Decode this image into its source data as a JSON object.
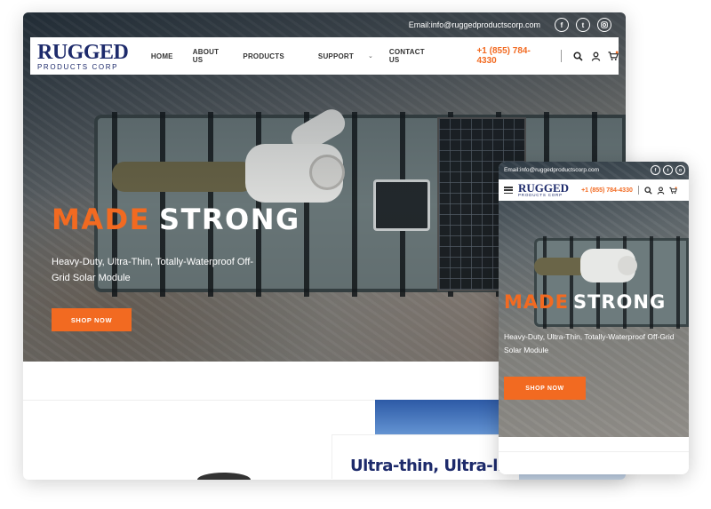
{
  "desktop": {
    "topbar": {
      "email": "Email:info@ruggedproductscorp.com",
      "socials": [
        "facebook-icon",
        "twitter-icon",
        "instagram-icon"
      ]
    },
    "logo": {
      "main": "RUGGED",
      "sub": "PRODUCTS CORP"
    },
    "nav": {
      "home": "HOME",
      "about": "ABOUT US",
      "products": "PRODUCTS",
      "support": "SUPPORT",
      "contact": "CONTACT US",
      "phone": "+1 (855) 784-4330",
      "icons": [
        "search-icon",
        "user-icon",
        "cart-icon"
      ]
    },
    "hero": {
      "title_orange": "MADE",
      "title_white": "STRONG",
      "subtitle": "Heavy-Duty, Ultra-Thin, Totally-Waterproof Off-Grid Solar Module",
      "cta": "SHOP NOW"
    },
    "lower": {
      "heading": "Ultra-thin, Ultra-light,"
    }
  },
  "mobile": {
    "topbar": {
      "email": "Email:info@ruggedproductscorp.com"
    },
    "logo": {
      "main": "RUGGED",
      "sub": "PRODUCTS CORP"
    },
    "phone": "+1 (855) 784-4330",
    "hero": {
      "title_orange": "MADE",
      "title_white": "STRONG",
      "subtitle": "Heavy-Duty, Ultra-Thin, Totally-Waterproof Off-Grid Solar Module",
      "cta": "SHOP NOW"
    }
  },
  "colors": {
    "accent": "#f26a21",
    "brand": "#1d2a6b"
  }
}
